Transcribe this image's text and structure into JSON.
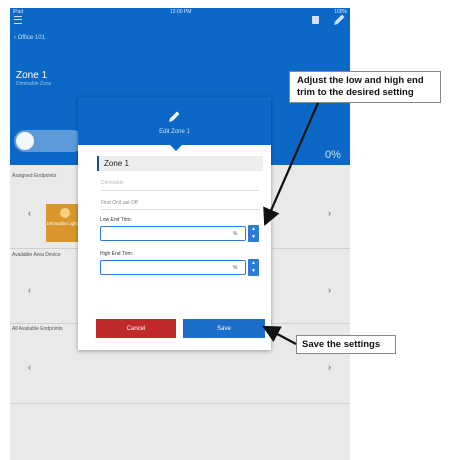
{
  "app": {
    "breadcrumb": "‹ Office 101",
    "zone_name": "Zone 1",
    "zone_subtitle": "Dimmable Zone",
    "level_text": "0%",
    "level_fraction": 0.0,
    "sections": {
      "assigned": "Assigned Endpoints",
      "available_area": "Available Area Device",
      "all_available": "All Available Endpoints"
    },
    "tile_label": "Dimmable Light # 1"
  },
  "dialog": {
    "title": "Edit Zone 1",
    "name_value": "Zone 1",
    "type_text": "Dimmable",
    "mode_text": "First On/Last Off",
    "low_trim_label": "Low End Trim:",
    "low_trim_unit": "%",
    "high_trim_label": "High End Trim:",
    "high_trim_unit": "%",
    "cancel_label": "Cancel",
    "save_label": "Save"
  },
  "annotations": {
    "trim_note_line1": "Adjust the low and high end",
    "trim_note_line2": "trim to the desired setting",
    "save_note": "Save the settings"
  },
  "colors": {
    "header_blue": "#0b68c6",
    "cancel_red": "#c02a2a",
    "save_blue": "#1c6dc9",
    "tile_orange": "#d8962c"
  },
  "icons": {
    "menu": "hamburger-icon",
    "delete": "trash-icon",
    "edit": "pencil-icon"
  }
}
